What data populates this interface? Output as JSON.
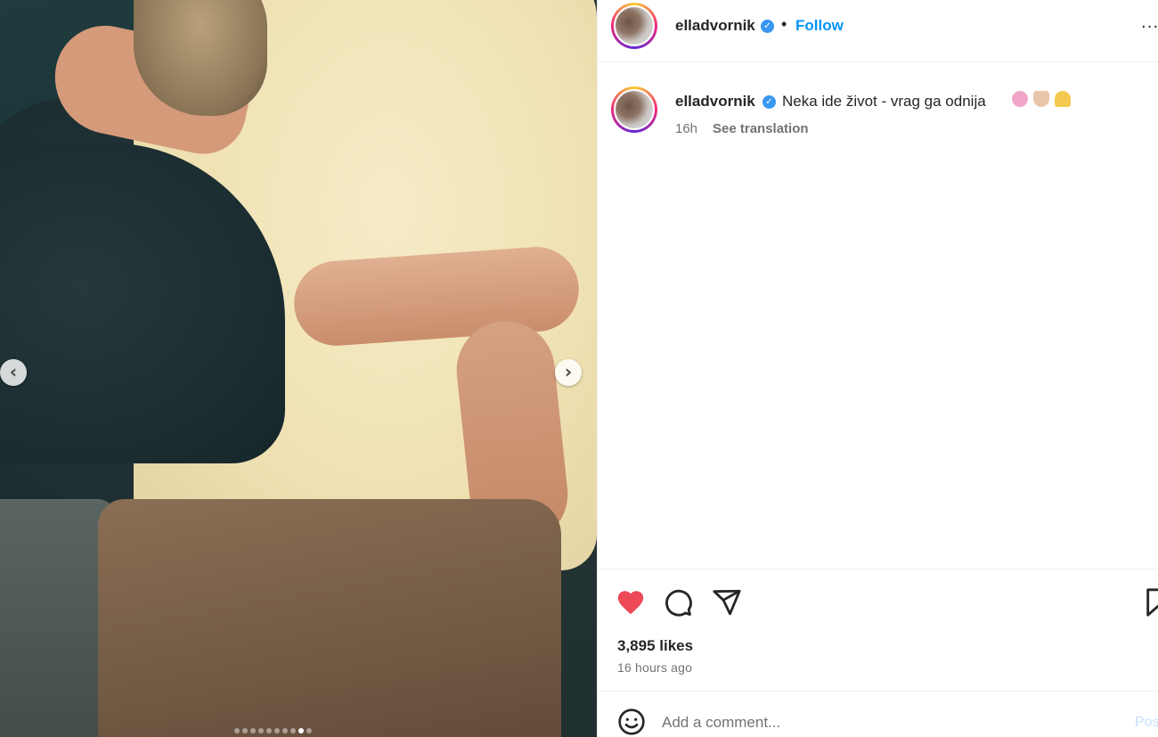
{
  "media": {
    "carousel_count": 10,
    "carousel_active_index": 8
  },
  "header": {
    "username": "elladvornik",
    "separator": "•",
    "follow_label": "Follow",
    "more_label": "..."
  },
  "caption": {
    "username": "elladvornik",
    "text": "Neka ide život - vrag ga odnija",
    "emojis": [
      "smiling-face-with-hearts",
      "heart-hands",
      "folded-hands"
    ],
    "time": "16h",
    "translate_label": "See translation"
  },
  "actions": {
    "likes": "3,895 likes",
    "time_ago": "16 hours ago",
    "like_color": "#ed4956"
  },
  "comment_bar": {
    "placeholder": "Add a comment...",
    "post_label": "Post"
  },
  "colors": {
    "link_blue": "#0095f6",
    "verified_blue": "#3897f0",
    "muted": "#737373"
  }
}
